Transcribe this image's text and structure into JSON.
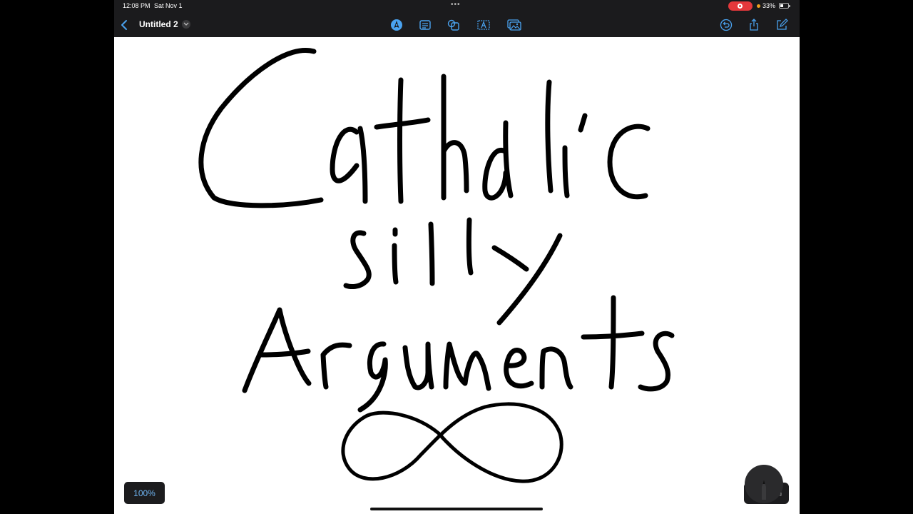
{
  "status_bar": {
    "time": "12:08 PM",
    "date": "Sat Nov 1",
    "battery_percent": "33%",
    "recording_color": "#e5383b"
  },
  "toolbar": {
    "back_icon": "chevron-left-icon",
    "document_title": "Untitled 2",
    "title_menu_icon": "chevron-down-icon",
    "tools": [
      "pen-tool-icon",
      "text-box-icon",
      "shapes-icon",
      "text-icon",
      "photo-icon"
    ],
    "actions": [
      "undo-icon",
      "share-icon",
      "compose-icon"
    ],
    "accent_color": "#4aa3f0"
  },
  "canvas": {
    "handwriting_lines": [
      "Catholic",
      "silly",
      "Arguments"
    ],
    "drawing": "infinity-symbol",
    "ink_color": "#000000"
  },
  "zoom": {
    "level": "100%"
  },
  "pencil_widget": {
    "icon": "pencil-icon"
  }
}
